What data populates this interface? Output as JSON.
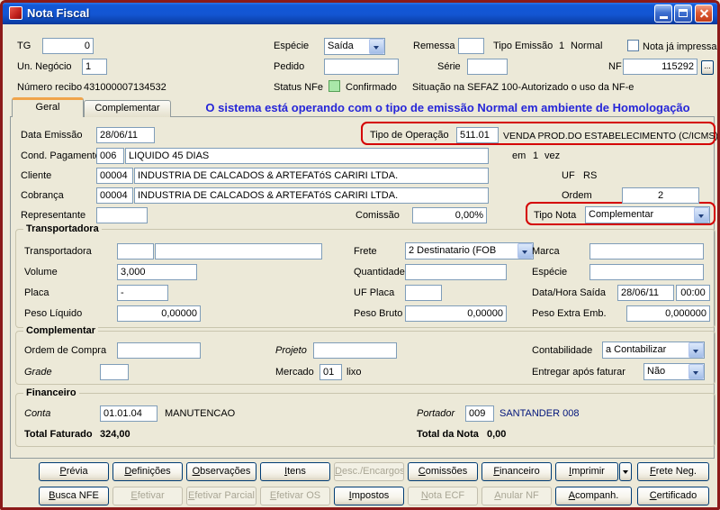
{
  "window": {
    "title": "Nota Fiscal"
  },
  "top": {
    "tg": {
      "label": "TG",
      "value": "0"
    },
    "especie": {
      "label": "Espécie",
      "value": "Saída"
    },
    "remessa": {
      "label": "Remessa",
      "value": ""
    },
    "tipo_emissao": {
      "label": "Tipo Emissão",
      "code": "1",
      "desc": "Normal"
    },
    "nota_impressa": {
      "label": "Nota já impressa"
    },
    "un_negocio": {
      "label": "Un. Negócio",
      "value": "1"
    },
    "pedido": {
      "label": "Pedido",
      "value": ""
    },
    "serie": {
      "label": "Série",
      "value": ""
    },
    "nf": {
      "label": "NF",
      "value": "115292",
      "lookup": "..."
    },
    "numero_recibo": {
      "label": "Número recibo",
      "value": "431000007134532"
    },
    "status_nfe": {
      "label": "Status NFe",
      "value": "Confirmado"
    },
    "sefaz": "Situação na SEFAZ 100-Autorizado o uso da NF-e"
  },
  "tabs": {
    "geral": "Geral",
    "complementar": "Complementar"
  },
  "banner": "O sistema está operando com o tipo de emissão Normal em ambiente de Homologação",
  "geral": {
    "data_emissao": {
      "label": "Data Emissão",
      "value": "28/06/11"
    },
    "tipo_operacao": {
      "label": "Tipo de Operação",
      "code": "511.01",
      "desc": "VENDA PROD.DO ESTABELECIMENTO (C/ICMS)"
    },
    "cond_pagamento": {
      "label": "Cond. Pagamento",
      "code": "006",
      "desc": "LIQUIDO 45 DIAS",
      "em": "em",
      "parcelas": "1",
      "vez": "vez"
    },
    "cliente": {
      "label": "Cliente",
      "code": "00004",
      "desc": "INDUSTRIA DE CALCADOS & ARTEFATóS CARIRI LTDA.",
      "uf_label": "UF",
      "uf": "RS"
    },
    "cobranca": {
      "label": "Cobrança",
      "code": "00004",
      "desc": "INDUSTRIA DE CALCADOS & ARTEFATóS CARIRI LTDA.",
      "ordem_label": "Ordem",
      "ordem": "2"
    },
    "representante": {
      "label": "Representante",
      "value": ""
    },
    "comissao": {
      "label": "Comissão",
      "value": "0,00%"
    },
    "tipo_nota": {
      "label": "Tipo Nota",
      "value": "Complementar"
    }
  },
  "transportadora": {
    "legend": "Transportadora",
    "transportadora": {
      "label": "Transportadora",
      "code": "",
      "desc": ""
    },
    "frete": {
      "label": "Frete",
      "value": "2 Destinatario (FOB"
    },
    "marca": {
      "label": "Marca",
      "value": ""
    },
    "volume": {
      "label": "Volume",
      "value": "3,000"
    },
    "quantidade": {
      "label": "Quantidade",
      "value": ""
    },
    "especie": {
      "label": "Espécie",
      "value": ""
    },
    "placa": {
      "label": "Placa",
      "value": "-"
    },
    "uf_placa": {
      "label": "UF Placa",
      "value": ""
    },
    "data_hora_saida": {
      "label": "Data/Hora Saída",
      "data": "28/06/11",
      "hora": "00:00"
    },
    "peso_liquido": {
      "label": "Peso Líquido",
      "value": "0,00000"
    },
    "peso_bruto": {
      "label": "Peso Bruto",
      "value": "0,00000"
    },
    "peso_extra": {
      "label": "Peso Extra Emb.",
      "value": "0,000000"
    }
  },
  "complementar_box": {
    "legend": "Complementar",
    "ordem_compra": {
      "label": "Ordem de Compra",
      "value": ""
    },
    "projeto": {
      "label": "Projeto",
      "value": ""
    },
    "contabilidade": {
      "label": "Contabilidade",
      "value": "a Contabilizar"
    },
    "grade": {
      "label": "Grade",
      "value": ""
    },
    "mercado": {
      "label": "Mercado",
      "code": "01",
      "desc": "lixo"
    },
    "entregar": {
      "label": "Entregar após faturar",
      "value": "Não"
    }
  },
  "financeiro": {
    "legend": "Financeiro",
    "conta": {
      "label": "Conta",
      "code": "01.01.04",
      "desc": "MANUTENCAO"
    },
    "portador": {
      "label": "Portador",
      "code": "009",
      "desc": "SANTANDER 008"
    },
    "total_faturado": {
      "label": "Total Faturado",
      "value": "324,00"
    },
    "total_nota": {
      "label": "Total da Nota",
      "value": "0,00"
    }
  },
  "buttons": {
    "row1": [
      {
        "label": "Prévia",
        "enabled": true
      },
      {
        "label": "Definições",
        "enabled": true
      },
      {
        "label": "Observações",
        "enabled": true
      },
      {
        "label": "Itens",
        "enabled": true
      },
      {
        "label": "Desc./Encargos",
        "enabled": false
      },
      {
        "label": "Comissões",
        "enabled": true
      },
      {
        "label": "Financeiro",
        "enabled": true
      },
      {
        "label": "Imprimir",
        "enabled": true
      },
      {
        "label": "Frete Neg.",
        "enabled": true
      }
    ],
    "row2": [
      {
        "label": "Busca NFE",
        "enabled": true
      },
      {
        "label": "Efetivar",
        "enabled": false
      },
      {
        "label": "Efetivar Parcial",
        "enabled": false
      },
      {
        "label": "Efetivar OS",
        "enabled": false
      },
      {
        "label": "Impostos",
        "enabled": true
      },
      {
        "label": "Nota ECF",
        "enabled": false
      },
      {
        "label": "Anular NF",
        "enabled": false
      },
      {
        "label": "Acompanh.",
        "enabled": true
      },
      {
        "label": "Certificado",
        "enabled": true
      }
    ]
  },
  "colors": {
    "banner_blue": "#2626D8",
    "annotation_red": "#D40000",
    "status_green": "#A9E8A9",
    "titlebar_blue": "#1355D2"
  }
}
